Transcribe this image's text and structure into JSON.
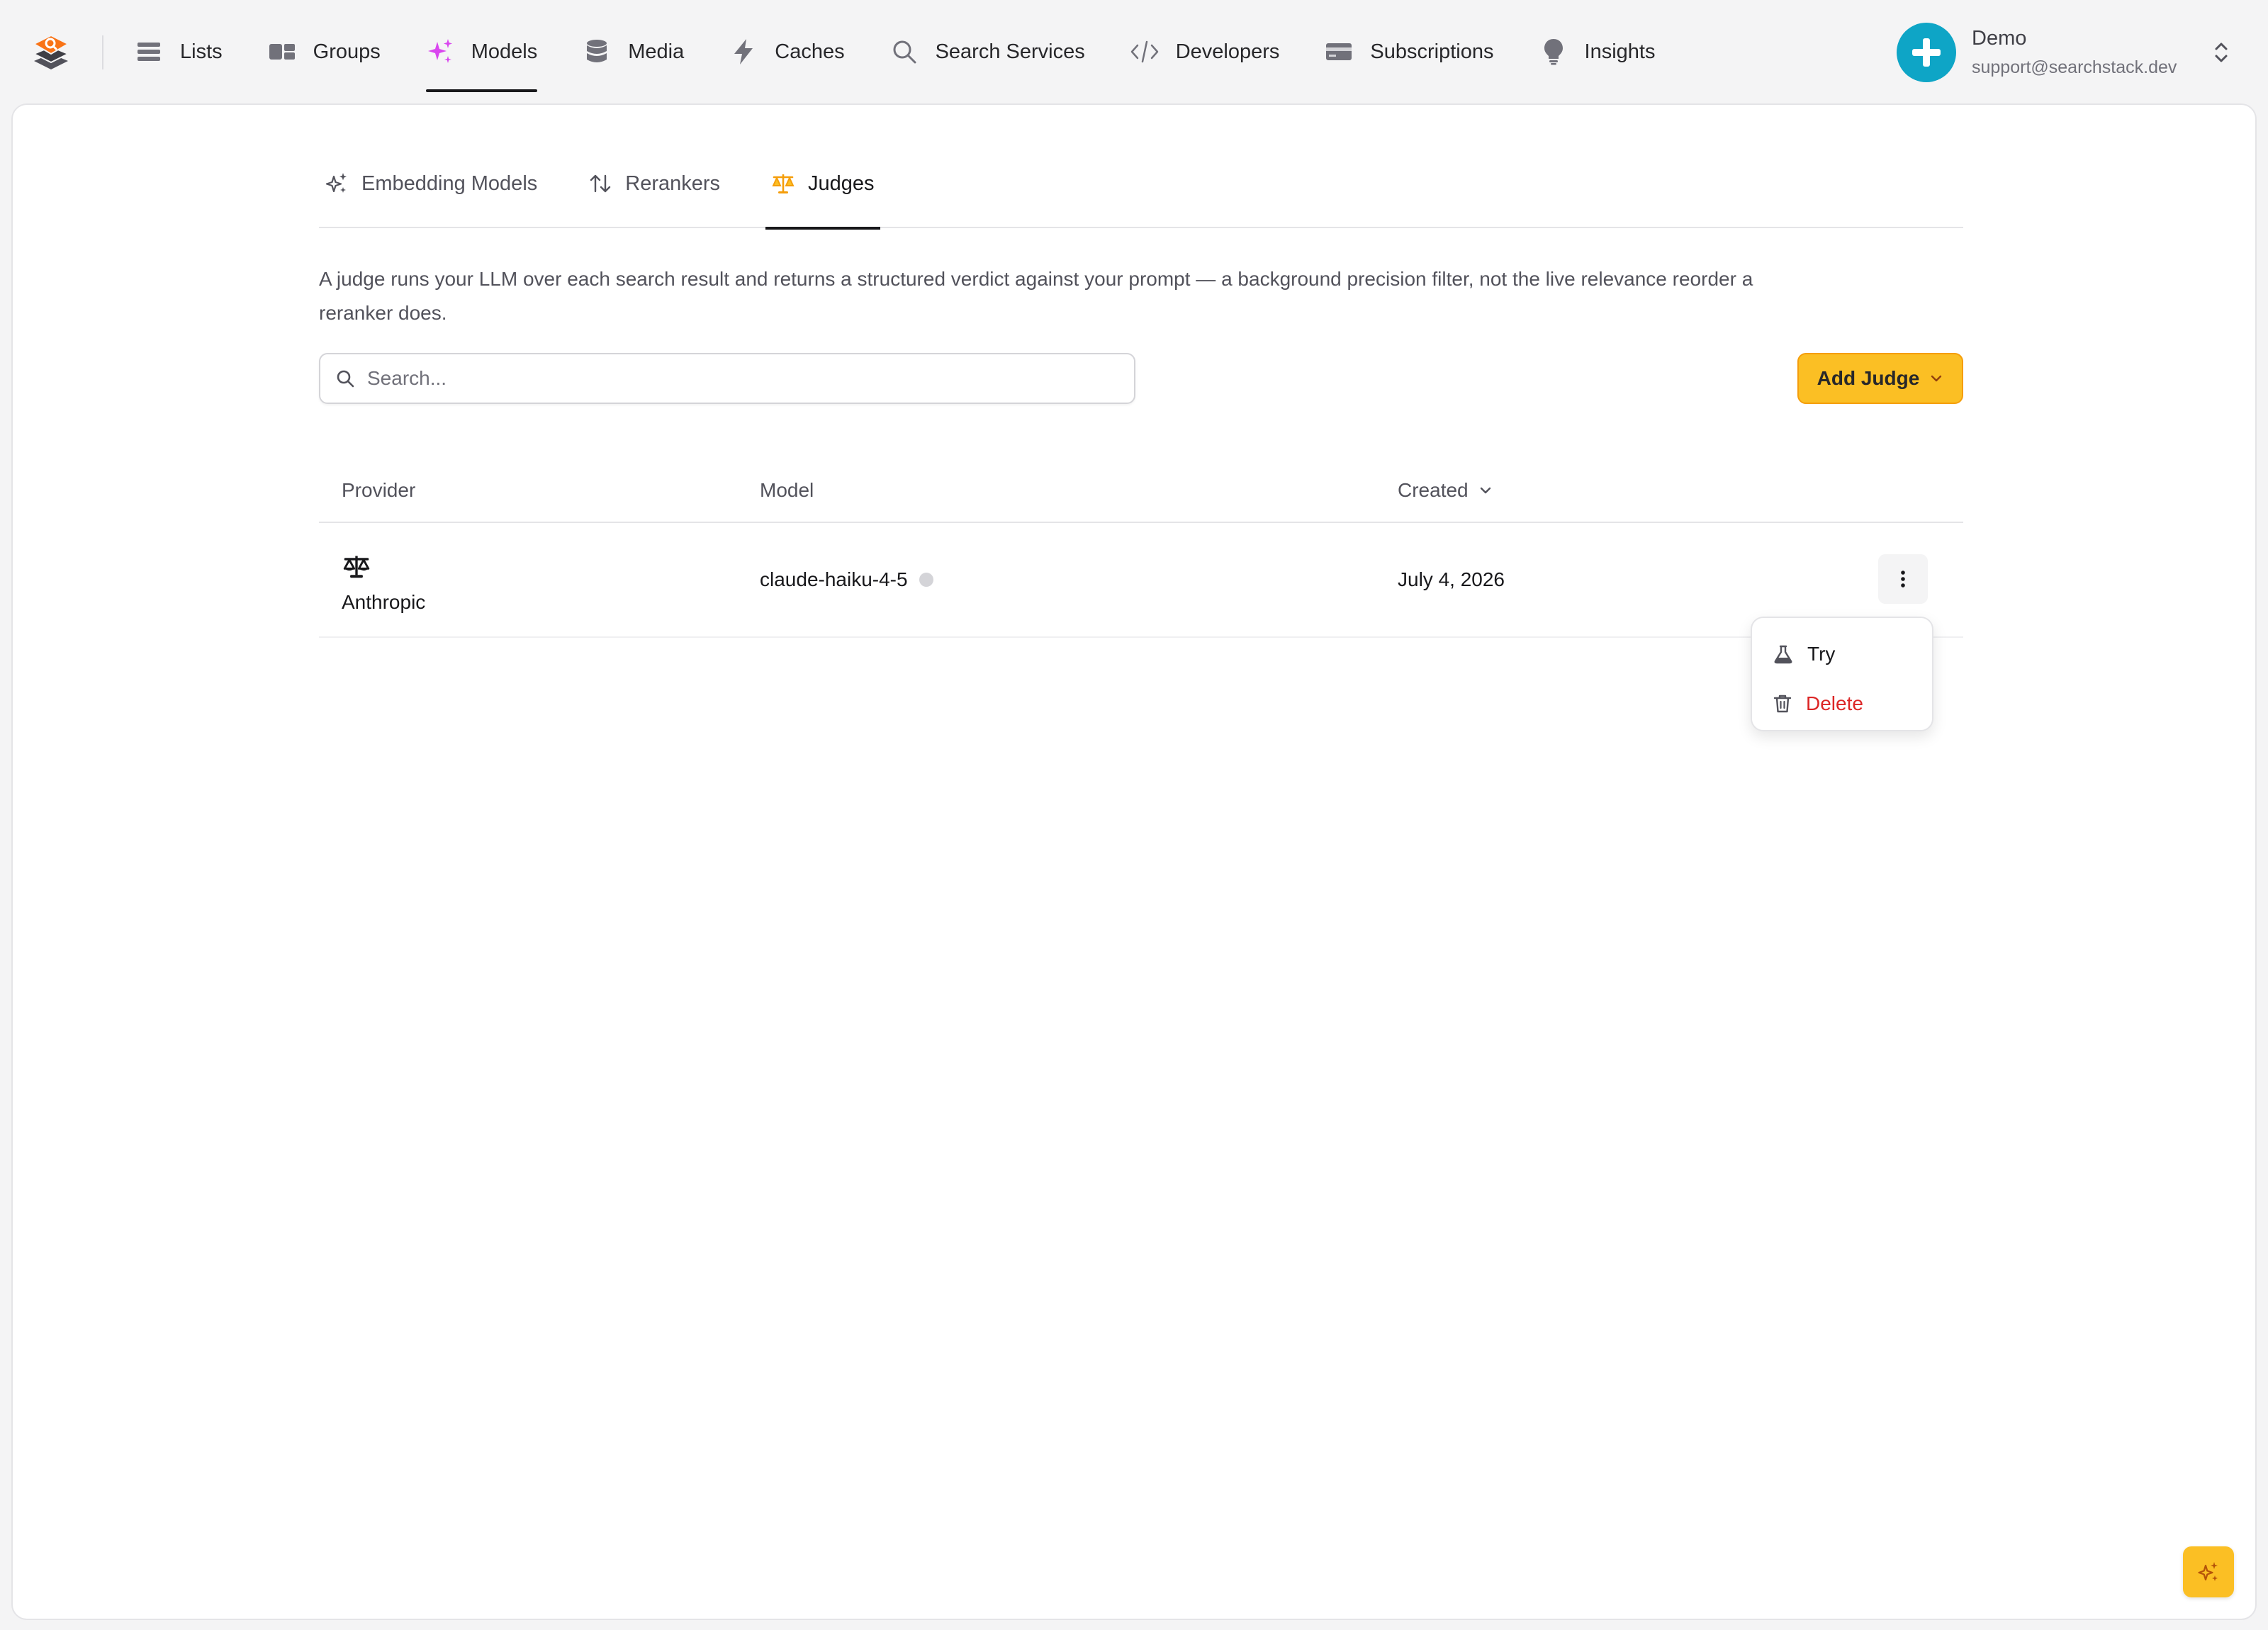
{
  "nav": {
    "items": [
      {
        "label": "Lists",
        "icon": "list-icon"
      },
      {
        "label": "Groups",
        "icon": "groups-icon"
      },
      {
        "label": "Models",
        "icon": "sparkles-icon",
        "active": true
      },
      {
        "label": "Media",
        "icon": "database-icon"
      },
      {
        "label": "Caches",
        "icon": "bolt-icon"
      },
      {
        "label": "Search Services",
        "icon": "search-icon"
      },
      {
        "label": "Developers",
        "icon": "code-icon"
      },
      {
        "label": "Subscriptions",
        "icon": "credit-card-icon"
      },
      {
        "label": "Insights",
        "icon": "lightbulb-icon"
      }
    ]
  },
  "account": {
    "name": "Demo",
    "email": "support@searchstack.dev"
  },
  "tabs": [
    {
      "label": "Embedding Models",
      "icon": "sparkles-icon"
    },
    {
      "label": "Rerankers",
      "icon": "arrows-up-down-icon"
    },
    {
      "label": "Judges",
      "icon": "scale-icon",
      "active": true
    }
  ],
  "description": "A judge runs your LLM over each search result and returns a structured verdict against your prompt — a background precision filter, not the live relevance reorder a reranker does.",
  "search": {
    "placeholder": "Search..."
  },
  "add_button": {
    "label": "Add Judge"
  },
  "table": {
    "columns": {
      "provider": "Provider",
      "model": "Model",
      "created": "Created"
    },
    "rows": [
      {
        "provider": "Anthropic",
        "model": "claude-haiku-4-5",
        "created": "July 4, 2026"
      }
    ]
  },
  "row_menu": {
    "try_label": "Try",
    "delete_label": "Delete"
  },
  "colors": {
    "accent": "#fbbf24",
    "active_nav_icon": "#d946ef",
    "avatar": "#0ea5c6",
    "danger": "#dc2626",
    "logo": "#f97316"
  }
}
